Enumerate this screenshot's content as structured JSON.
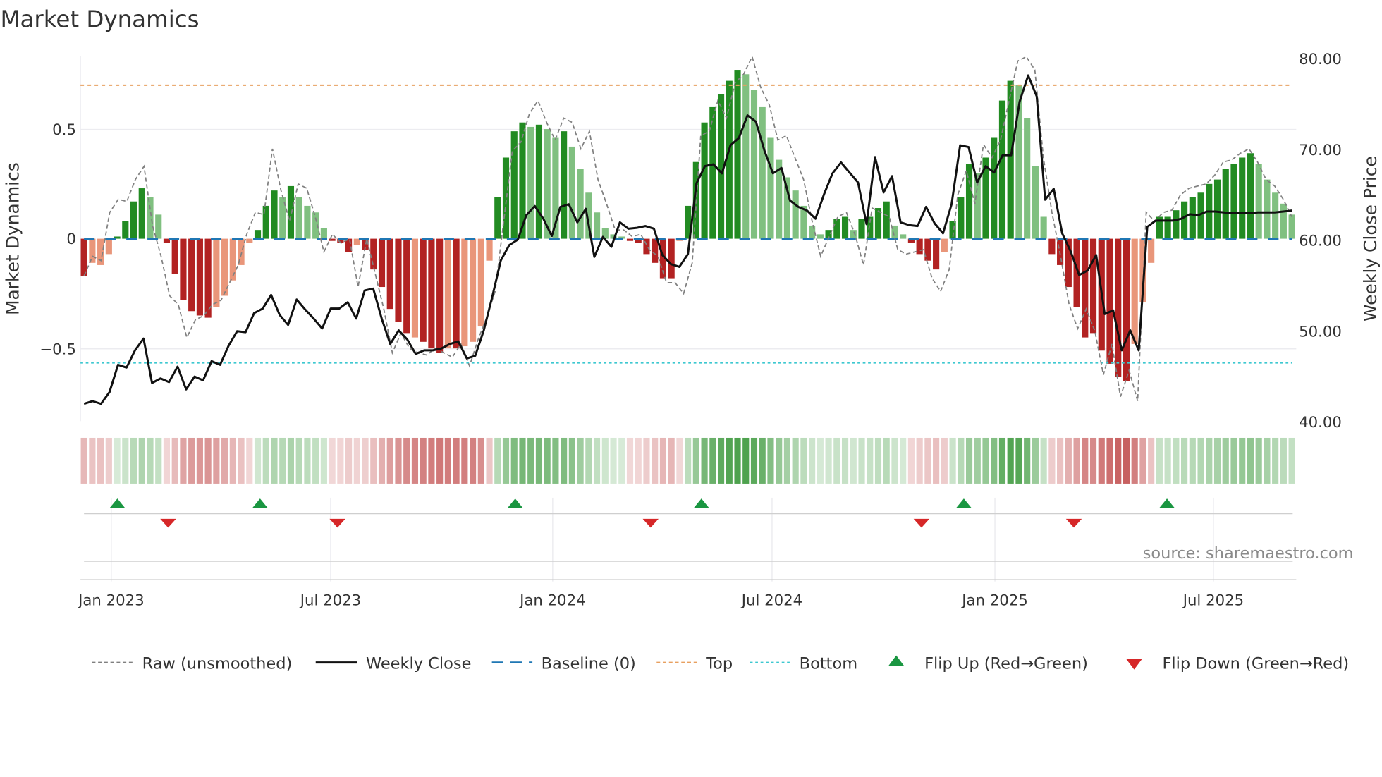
{
  "title": "Market Dynamics",
  "source": "source: sharemaestro.com",
  "colors": {
    "bar_up_strong": "#228b22",
    "bar_up_weak": "#80c080",
    "bar_down_strong": "#b22222",
    "bar_down_weak": "#e9967a",
    "raw": "#808080",
    "close": "#111111",
    "baseline": "#1f77b4",
    "top": "#e8a060",
    "bottom": "#3cc8d0",
    "flip_up": "#1a9641",
    "flip_down": "#d62728"
  },
  "chart_data": {
    "type": "bar",
    "title": "Market Dynamics",
    "xlabel": "",
    "ylabel": "Market Dynamics",
    "y2label": "Weekly Close Price",
    "x_start": "2022-12-09",
    "x_end": "2025-08-22",
    "ylim": [
      -0.77,
      0.83
    ],
    "y2lim": [
      40,
      80
    ],
    "yticks": [
      "0.5",
      "0",
      "−0.5"
    ],
    "y2ticks": [
      "80.00",
      "70.00",
      "60.00",
      "50.00",
      "40.00"
    ],
    "xticks": [
      "Jan 2023",
      "Jul 2023",
      "Jan 2024",
      "Jul 2024",
      "Jan 2025",
      "Jul 2025"
    ],
    "top_level": 0.7,
    "bottom_level": -0.566,
    "baseline": 0,
    "dynamics": [
      -0.17,
      -0.11,
      -0.12,
      -0.07,
      0.01,
      0.08,
      0.17,
      0.23,
      0.19,
      0.11,
      -0.02,
      -0.16,
      -0.28,
      -0.33,
      -0.35,
      -0.36,
      -0.31,
      -0.26,
      -0.19,
      -0.12,
      -0.02,
      0.04,
      0.15,
      0.22,
      0.19,
      0.24,
      0.19,
      0.15,
      0.12,
      0.05,
      -0.01,
      -0.02,
      -0.06,
      -0.03,
      -0.05,
      -0.14,
      -0.22,
      -0.32,
      -0.38,
      -0.43,
      -0.45,
      -0.47,
      -0.5,
      -0.52,
      -0.5,
      -0.5,
      -0.49,
      -0.47,
      -0.4,
      -0.1,
      0.19,
      0.37,
      0.49,
      0.53,
      0.51,
      0.52,
      0.5,
      0.46,
      0.49,
      0.42,
      0.32,
      0.21,
      0.12,
      0.05,
      0.02,
      0.01,
      -0.01,
      -0.02,
      -0.07,
      -0.11,
      -0.18,
      -0.18,
      -0.01,
      0.15,
      0.35,
      0.53,
      0.6,
      0.66,
      0.72,
      0.77,
      0.75,
      0.68,
      0.6,
      0.46,
      0.36,
      0.28,
      0.22,
      0.15,
      0.06,
      0.02,
      0.04,
      0.09,
      0.1,
      0.04,
      0.09,
      0.1,
      0.14,
      0.17,
      0.06,
      0.02,
      -0.02,
      -0.07,
      -0.1,
      -0.14,
      -0.06,
      0.08,
      0.19,
      0.34,
      0.3,
      0.37,
      0.46,
      0.63,
      0.72,
      0.7,
      0.55,
      0.33,
      0.1,
      -0.07,
      -0.12,
      -0.22,
      -0.31,
      -0.45,
      -0.43,
      -0.51,
      -0.57,
      -0.63,
      -0.65,
      -0.48,
      -0.29,
      -0.11,
      0.1,
      0.1,
      0.13,
      0.17,
      0.19,
      0.21,
      0.25,
      0.27,
      0.32,
      0.34,
      0.37,
      0.39,
      0.34,
      0.27,
      0.21,
      0.16,
      0.11
    ],
    "strong": [
      1,
      0,
      0,
      0,
      1,
      1,
      1,
      1,
      0,
      0,
      1,
      1,
      1,
      1,
      1,
      1,
      0,
      0,
      0,
      0,
      0,
      1,
      1,
      1,
      0,
      1,
      0,
      0,
      0,
      0,
      1,
      1,
      1,
      0,
      1,
      1,
      1,
      1,
      1,
      1,
      0,
      1,
      1,
      1,
      0,
      1,
      0,
      0,
      0,
      0,
      1,
      1,
      1,
      1,
      0,
      1,
      0,
      0,
      1,
      0,
      0,
      0,
      0,
      0,
      0,
      0,
      1,
      1,
      1,
      1,
      1,
      1,
      0,
      1,
      1,
      1,
      1,
      1,
      1,
      1,
      0,
      0,
      0,
      0,
      0,
      0,
      0,
      0,
      0,
      0,
      1,
      1,
      1,
      0,
      1,
      1,
      1,
      1,
      0,
      0,
      1,
      1,
      1,
      1,
      0,
      1,
      1,
      1,
      0,
      1,
      1,
      1,
      1,
      0,
      0,
      0,
      0,
      1,
      1,
      1,
      1,
      1,
      1,
      1,
      1,
      1,
      1,
      0,
      0,
      0,
      1,
      1,
      1,
      1,
      1,
      1,
      1,
      1,
      1,
      1,
      1,
      1,
      0,
      0,
      0,
      0,
      0
    ],
    "raw": [
      -0.17,
      -0.08,
      -0.1,
      0.12,
      0.18,
      0.17,
      0.27,
      0.33,
      0.06,
      -0.08,
      -0.26,
      -0.3,
      -0.45,
      -0.37,
      -0.35,
      -0.3,
      -0.28,
      -0.2,
      -0.12,
      0.02,
      0.12,
      0.11,
      0.41,
      0.22,
      0.08,
      0.25,
      0.23,
      0.1,
      -0.06,
      0.02,
      -0.02,
      0.0,
      -0.22,
      0.0,
      -0.16,
      -0.32,
      -0.52,
      -0.43,
      -0.5,
      -0.52,
      -0.53,
      -0.5,
      -0.52,
      -0.54,
      -0.48,
      -0.58,
      -0.46,
      -0.36,
      -0.24,
      0.08,
      0.4,
      0.44,
      0.57,
      0.63,
      0.53,
      0.45,
      0.55,
      0.53,
      0.41,
      0.49,
      0.27,
      0.16,
      0.04,
      0.04,
      0.01,
      0.02,
      -0.05,
      -0.08,
      -0.2,
      -0.2,
      -0.25,
      -0.11,
      0.47,
      0.49,
      0.63,
      0.55,
      0.71,
      0.75,
      0.83,
      0.69,
      0.61,
      0.45,
      0.47,
      0.37,
      0.27,
      0.08,
      -0.08,
      0.01,
      0.1,
      0.12,
      0.02,
      -0.12,
      0.14,
      0.12,
      0.1,
      -0.05,
      -0.07,
      -0.06,
      -0.05,
      -0.18,
      -0.24,
      -0.14,
      0.2,
      0.31,
      0.16,
      0.43,
      0.37,
      0.45,
      0.63,
      0.81,
      0.83,
      0.77,
      0.37,
      0.12,
      -0.08,
      -0.3,
      -0.41,
      -0.32,
      -0.42,
      -0.62,
      -0.48,
      -0.72,
      -0.6,
      -0.74,
      0.12,
      0.08,
      0.12,
      0.13,
      0.2,
      0.23,
      0.24,
      0.25,
      0.29,
      0.35,
      0.36,
      0.39,
      0.41,
      0.35,
      0.27,
      0.24,
      0.18,
      0.1
    ],
    "close": [
      41.9,
      42.2,
      41.9,
      43.2,
      46.2,
      45.9,
      47.8,
      49.1,
      44.2,
      44.7,
      44.3,
      46.0,
      43.5,
      44.9,
      44.5,
      46.6,
      46.2,
      48.3,
      49.9,
      49.8,
      51.9,
      52.4,
      53.9,
      51.7,
      50.6,
      53.4,
      52.3,
      51.3,
      50.2,
      52.4,
      52.4,
      53.1,
      51.3,
      54.4,
      54.6,
      51.3,
      48.5,
      50.0,
      49.0,
      47.4,
      47.8,
      47.8,
      48.0,
      48.5,
      48.8,
      46.9,
      47.2,
      50.0,
      53.7,
      57.7,
      59.4,
      60.0,
      62.7,
      63.7,
      62.3,
      60.4,
      63.6,
      63.9,
      61.9,
      63.4,
      58.1,
      60.3,
      59.2,
      61.9,
      61.2,
      61.3,
      61.5,
      61.2,
      58.3,
      57.3,
      57.0,
      58.4,
      66.2,
      68.1,
      68.3,
      67.3,
      70.4,
      71.2,
      73.7,
      73.0,
      69.8,
      67.3,
      67.9,
      64.3,
      63.6,
      63.2,
      62.3,
      65.0,
      67.3,
      68.5,
      67.4,
      66.3,
      61.7,
      69.1,
      65.2,
      67.0,
      61.9,
      61.6,
      61.5,
      63.6,
      61.8,
      60.7,
      63.9,
      70.4,
      70.2,
      66.3,
      68.1,
      67.4,
      69.3,
      69.3,
      75.2,
      78.1,
      75.8,
      64.4,
      65.6,
      60.7,
      58.7,
      56.1,
      56.6,
      58.3,
      51.8,
      52.2,
      47.8,
      50.0,
      47.8,
      61.4,
      62.1,
      62.1,
      62.1,
      62.3,
      62.8,
      62.7,
      63.1,
      63.1,
      63.0,
      62.9,
      62.9,
      62.9,
      63.0,
      63.0,
      63.0,
      63.1,
      63.2
    ],
    "flip_up": [
      "2023-01-06",
      "2023-05-04",
      "2023-12-01",
      "2024-05-03",
      "2024-12-06",
      "2025-05-23"
    ],
    "flip_down": [
      "2023-02-17",
      "2023-07-07",
      "2024-03-22",
      "2024-11-01",
      "2025-03-07"
    ],
    "legend": {
      "placement": "bottom",
      "items": [
        "Raw (unsmoothed)",
        "Weekly Close",
        "Baseline (0)",
        "Top",
        "Bottom",
        "Flip Up (Red→Green)",
        "Flip Down (Green→Red)"
      ]
    }
  }
}
